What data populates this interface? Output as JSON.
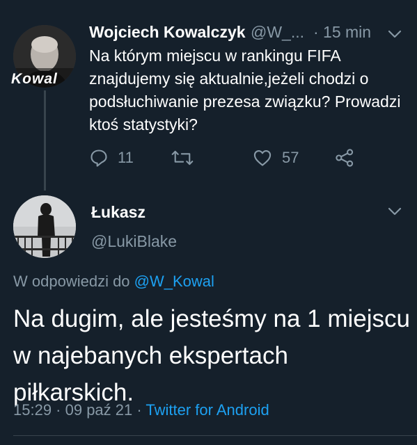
{
  "parent": {
    "display_name": "Wojciech Kowalczyk",
    "handle": "@W_...",
    "time": "· 15 min",
    "text": "Na którym miejscu w rankingu FIFA znajdujemy się aktualnie,jeżeli chodzi o podsłuchiwanie prezesa związku? Prowadzi ktoś statystyki?",
    "avatar_overlay_text": "Kowal",
    "actions": {
      "reply_count": "11",
      "retweet_count": "",
      "like_count": "57"
    }
  },
  "reply": {
    "display_name": "Łukasz",
    "handle": "@LukiBlake",
    "reply_prefix": "W odpowiedzi do",
    "reply_mention": "@W_Kowal",
    "text": "Na  dugim, ale jesteśmy na 1 miejscu w najebanych ekspertach piłkarskich.",
    "timestamp": "15:29 · 09 paź 21 ·",
    "source": "Twitter for Android"
  },
  "colors": {
    "background": "#15202b",
    "secondary_text": "#8899a6",
    "accent": "#1da1f2",
    "divider": "#38444d"
  }
}
